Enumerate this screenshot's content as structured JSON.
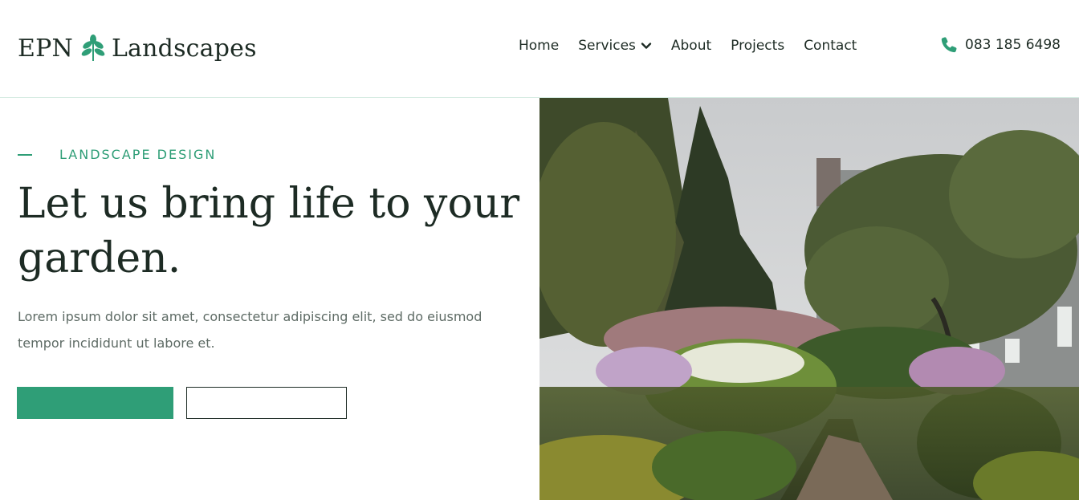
{
  "brand": {
    "name_part1": "EPN",
    "name_part2": "Landscapes",
    "logo_icon": "leaf-icon",
    "accent_color": "#2f9e77"
  },
  "nav": {
    "items": [
      {
        "label": "Home"
      },
      {
        "label": "Services",
        "has_dropdown": true
      },
      {
        "label": "About"
      },
      {
        "label": "Projects"
      },
      {
        "label": "Contact"
      }
    ]
  },
  "contact": {
    "phone": "083 185 6498",
    "phone_icon": "phone-icon"
  },
  "hero": {
    "eyebrow": "LANDSCAPE DESIGN",
    "headline": "Let us bring life to your garden.",
    "description": "Lorem ipsum dolor sit amet, consectetur adipiscing elit, sed do eiusmod tempor incididunt ut labore et.",
    "image_alt": "garden-photo"
  }
}
